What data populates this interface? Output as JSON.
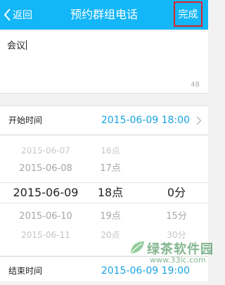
{
  "header": {
    "back_label": "返回",
    "title": "预约群组电话",
    "done_label": "完成",
    "bg_color": "#13b6f6",
    "done_highlight_color": "#d8262c"
  },
  "topic": {
    "text": "会议",
    "char_count": "48"
  },
  "start_time": {
    "label": "开始时间",
    "value": "2015-06-09 18:00"
  },
  "picker": {
    "rows": [
      {
        "date": "2015-06-07",
        "hour": "16点",
        "minute": ""
      },
      {
        "date": "2015-06-08",
        "hour": "17点",
        "minute": ""
      },
      {
        "date": "2015-06-09",
        "hour": "18点",
        "minute": "0分"
      },
      {
        "date": "2015-06-10",
        "hour": "19点",
        "minute": "15分"
      },
      {
        "date": "2015-06-11",
        "hour": "20点",
        "minute": "30分"
      }
    ]
  },
  "end_time": {
    "label": "结束时间",
    "value": "2015-06-09 19:00"
  },
  "watermark": {
    "text": "绿茶软件园",
    "url": "www.33lc.com"
  }
}
